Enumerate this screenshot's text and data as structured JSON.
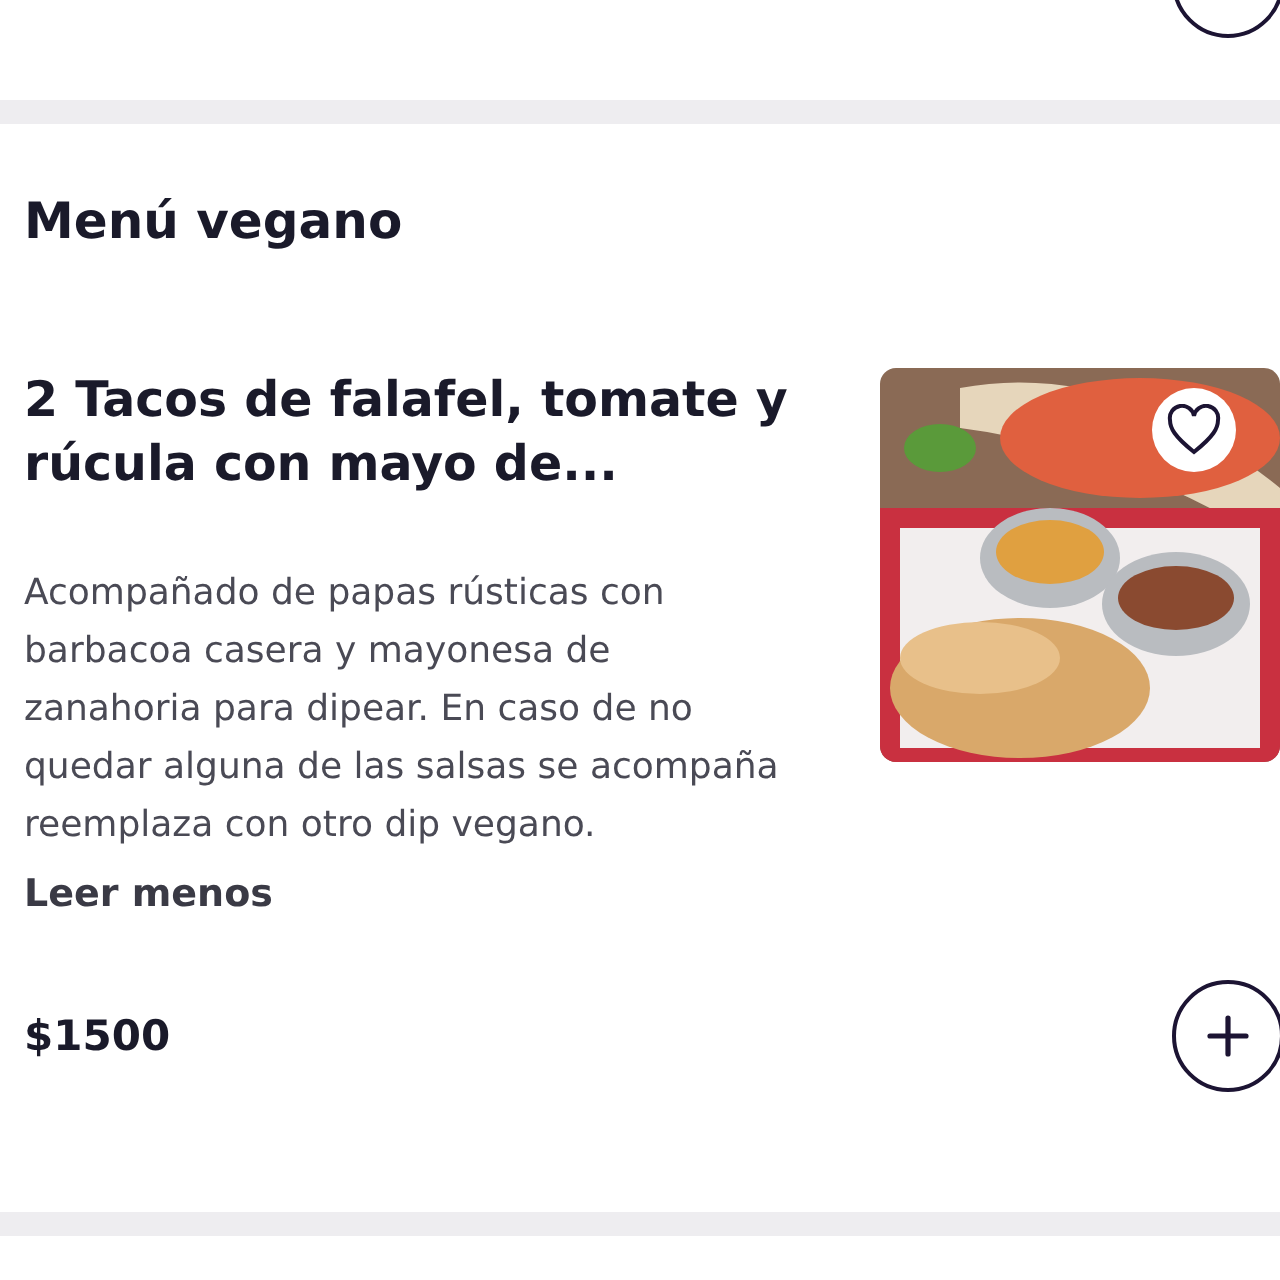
{
  "section": {
    "title": "Menú vegano"
  },
  "dish": {
    "name": "2 Tacos de falafel, tomate y rúcula con mayo de...",
    "description": "Acompañado de papas rústicas con barbacoa casera y mayonesa de zanahoria para dipear. En caso de no quedar alguna de las salsas se acompaña reemplaza con otro dip vegano.",
    "toggle": "Leer menos",
    "price": "$1500",
    "favorited": false
  }
}
